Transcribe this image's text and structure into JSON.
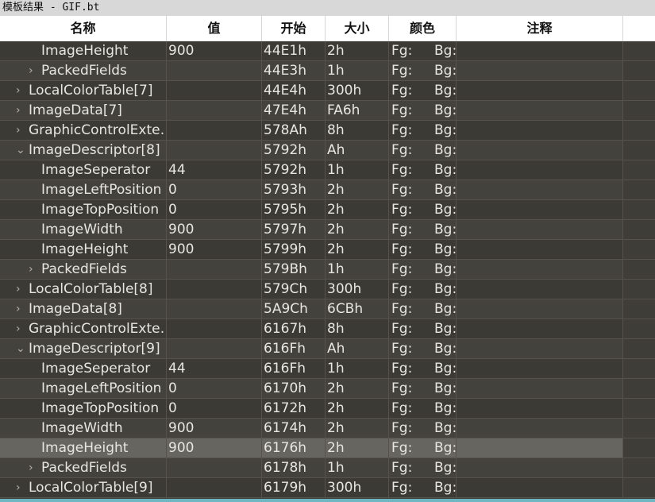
{
  "window": {
    "title": "模板结果 - GIF.bt"
  },
  "columns": [
    "名称",
    "值",
    "开始",
    "大小",
    "颜色",
    "注释"
  ],
  "color_labels": {
    "fg": "Fg:",
    "bg": "Bg:"
  },
  "rows": [
    {
      "name": "ImageHeight",
      "value": "900",
      "start": "44E1h",
      "size": "2h",
      "level": 2,
      "expander": "none"
    },
    {
      "name": "PackedFields",
      "value": "",
      "start": "44E3h",
      "size": "1h",
      "level": 2,
      "expander": "collapsed"
    },
    {
      "name": "LocalColorTable[7]",
      "value": "",
      "start": "44E4h",
      "size": "300h",
      "level": 1,
      "expander": "collapsed"
    },
    {
      "name": "ImageData[7]",
      "value": "",
      "start": "47E4h",
      "size": "FA6h",
      "level": 1,
      "expander": "collapsed"
    },
    {
      "name": "GraphicControlExte…",
      "value": "",
      "start": "578Ah",
      "size": "8h",
      "level": 1,
      "expander": "collapsed"
    },
    {
      "name": "ImageDescriptor[8]",
      "value": "",
      "start": "5792h",
      "size": "Ah",
      "level": 1,
      "expander": "expanded"
    },
    {
      "name": "ImageSeperator",
      "value": "44",
      "start": "5792h",
      "size": "1h",
      "level": 2,
      "expander": "none"
    },
    {
      "name": "ImageLeftPosition",
      "value": "0",
      "start": "5793h",
      "size": "2h",
      "level": 2,
      "expander": "none"
    },
    {
      "name": "ImageTopPosition",
      "value": "0",
      "start": "5795h",
      "size": "2h",
      "level": 2,
      "expander": "none"
    },
    {
      "name": "ImageWidth",
      "value": "900",
      "start": "5797h",
      "size": "2h",
      "level": 2,
      "expander": "none"
    },
    {
      "name": "ImageHeight",
      "value": "900",
      "start": "5799h",
      "size": "2h",
      "level": 2,
      "expander": "none"
    },
    {
      "name": "PackedFields",
      "value": "",
      "start": "579Bh",
      "size": "1h",
      "level": 2,
      "expander": "collapsed"
    },
    {
      "name": "LocalColorTable[8]",
      "value": "",
      "start": "579Ch",
      "size": "300h",
      "level": 1,
      "expander": "collapsed"
    },
    {
      "name": "ImageData[8]",
      "value": "",
      "start": "5A9Ch",
      "size": "6CBh",
      "level": 1,
      "expander": "collapsed"
    },
    {
      "name": "GraphicControlExte…",
      "value": "",
      "start": "6167h",
      "size": "8h",
      "level": 1,
      "expander": "collapsed"
    },
    {
      "name": "ImageDescriptor[9]",
      "value": "",
      "start": "616Fh",
      "size": "Ah",
      "level": 1,
      "expander": "expanded"
    },
    {
      "name": "ImageSeperator",
      "value": "44",
      "start": "616Fh",
      "size": "1h",
      "level": 2,
      "expander": "none"
    },
    {
      "name": "ImageLeftPosition",
      "value": "0",
      "start": "6170h",
      "size": "2h",
      "level": 2,
      "expander": "none"
    },
    {
      "name": "ImageTopPosition",
      "value": "0",
      "start": "6172h",
      "size": "2h",
      "level": 2,
      "expander": "none"
    },
    {
      "name": "ImageWidth",
      "value": "900",
      "start": "6174h",
      "size": "2h",
      "level": 2,
      "expander": "none"
    },
    {
      "name": "ImageHeight",
      "value": "900",
      "start": "6176h",
      "size": "2h",
      "level": 2,
      "expander": "none",
      "selected": true
    },
    {
      "name": "PackedFields",
      "value": "",
      "start": "6178h",
      "size": "1h",
      "level": 2,
      "expander": "collapsed"
    },
    {
      "name": "LocalColorTable[9]",
      "value": "",
      "start": "6179h",
      "size": "300h",
      "level": 1,
      "expander": "collapsed"
    }
  ]
}
